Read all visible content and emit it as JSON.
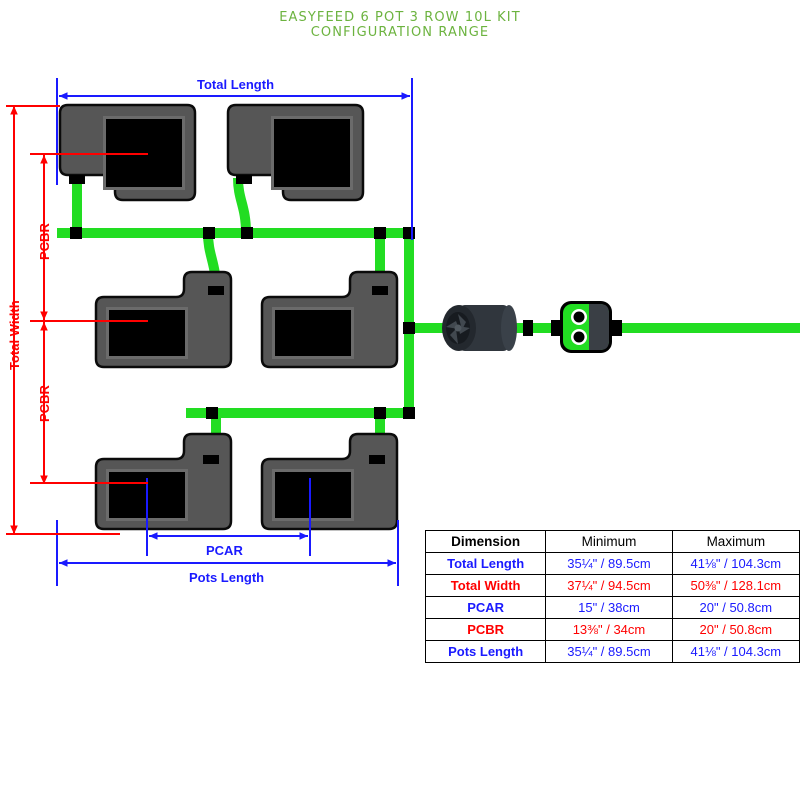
{
  "title": {
    "line1": "EASYFEED 6 POT 3 ROW 10L KIT",
    "line2": "CONFIGURATION RANGE"
  },
  "colors": {
    "title_green": "#6cb33f",
    "pipe_green": "#22dd22",
    "dim_blue": "#1a1aff",
    "dim_red": "#ff0000",
    "pot_body": "#565656",
    "pot_inner_rim": "#6b6b6b",
    "pot_soil": "#000000",
    "connector_black": "#000000",
    "pump_dark": "#2a2f35"
  },
  "dimensions": {
    "total_length": "Total Length",
    "total_width": "Total Width",
    "pcar": "PCAR",
    "pcbr_upper": "PCBR",
    "pcbr_lower": "PCBR",
    "pots_length": "Pots Length"
  },
  "table": {
    "headers": [
      "Dimension",
      "Minimum",
      "Maximum"
    ],
    "rows": [
      {
        "style": "blue",
        "dimension": "Total Length",
        "minimum": "35¼\" / 89.5cm",
        "maximum": "41⅛\" / 104.3cm"
      },
      {
        "style": "red",
        "dimension": "Total Width",
        "minimum": "37¼\" / 94.5cm",
        "maximum": "50⅜\" / 128.1cm"
      },
      {
        "style": "blue",
        "dimension": "PCAR",
        "minimum": "15\" / 38cm",
        "maximum": "20\" / 50.8cm"
      },
      {
        "style": "red",
        "dimension": "PCBR",
        "minimum": "13⅜\" / 34cm",
        "maximum": "20\" / 50.8cm"
      },
      {
        "style": "blue",
        "dimension": "Pots Length",
        "minimum": "35¼\" / 89.5cm",
        "maximum": "41⅛\" / 104.3cm"
      }
    ]
  },
  "components": {
    "pot_count": 6,
    "row_count": 3,
    "pump_label": "pump",
    "valve_label": "valve-manifold",
    "valve_outlets": 2
  }
}
